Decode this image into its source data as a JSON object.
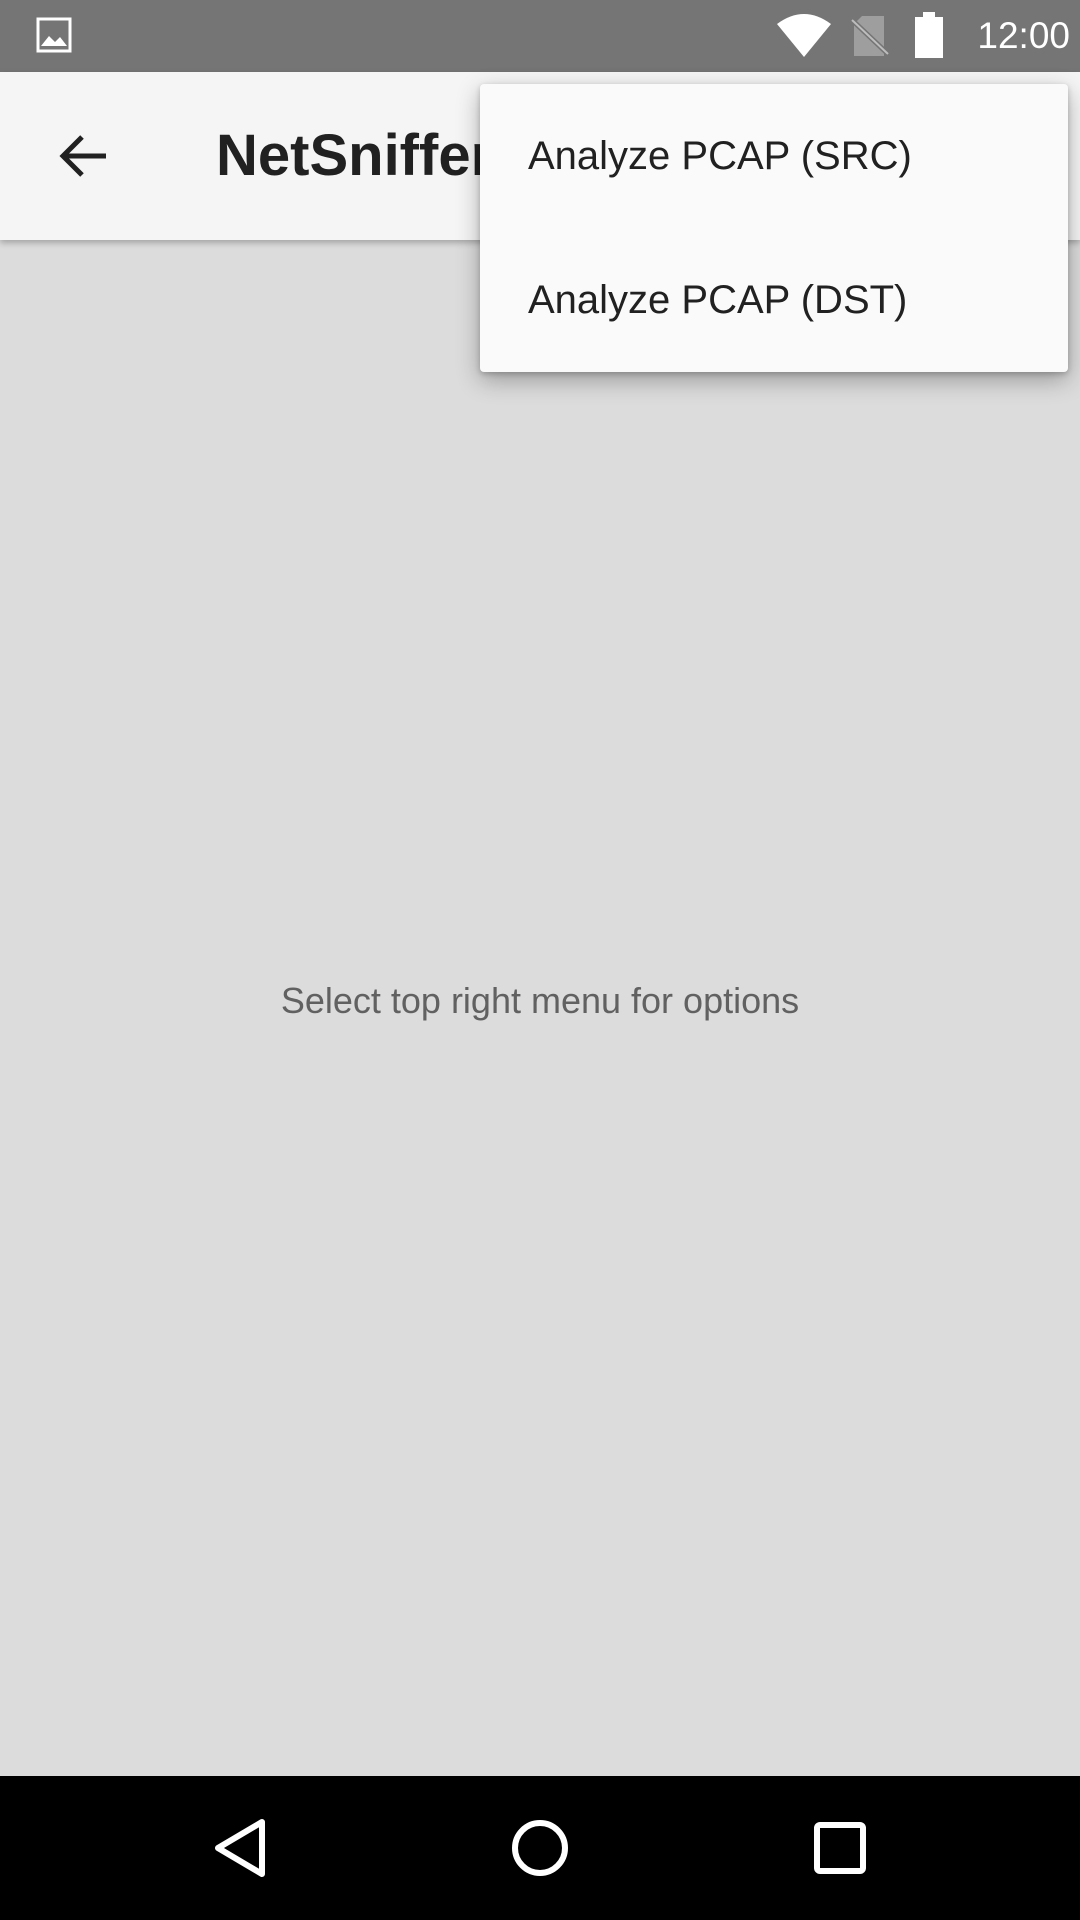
{
  "status_bar": {
    "time": "12:00",
    "icons": [
      "gallery-icon",
      "wifi-icon",
      "no-sim-icon",
      "battery-icon"
    ]
  },
  "app_bar": {
    "title": "NetSniffer",
    "back_icon": "arrow-left-icon"
  },
  "content": {
    "hint": "Select top right menu for options"
  },
  "overflow_menu": {
    "items": [
      {
        "label": "Analyze PCAP (SRC)"
      },
      {
        "label": "Analyze PCAP (DST)"
      }
    ]
  },
  "nav_bar": {
    "icons": [
      "back-triangle-icon",
      "home-circle-icon",
      "recents-square-icon"
    ]
  },
  "colors": {
    "status_bar": "#757575",
    "app_bar": "#f5f5f5",
    "background": "#dcdcdc",
    "menu": "#fafafa",
    "nav_bar": "#000000"
  }
}
